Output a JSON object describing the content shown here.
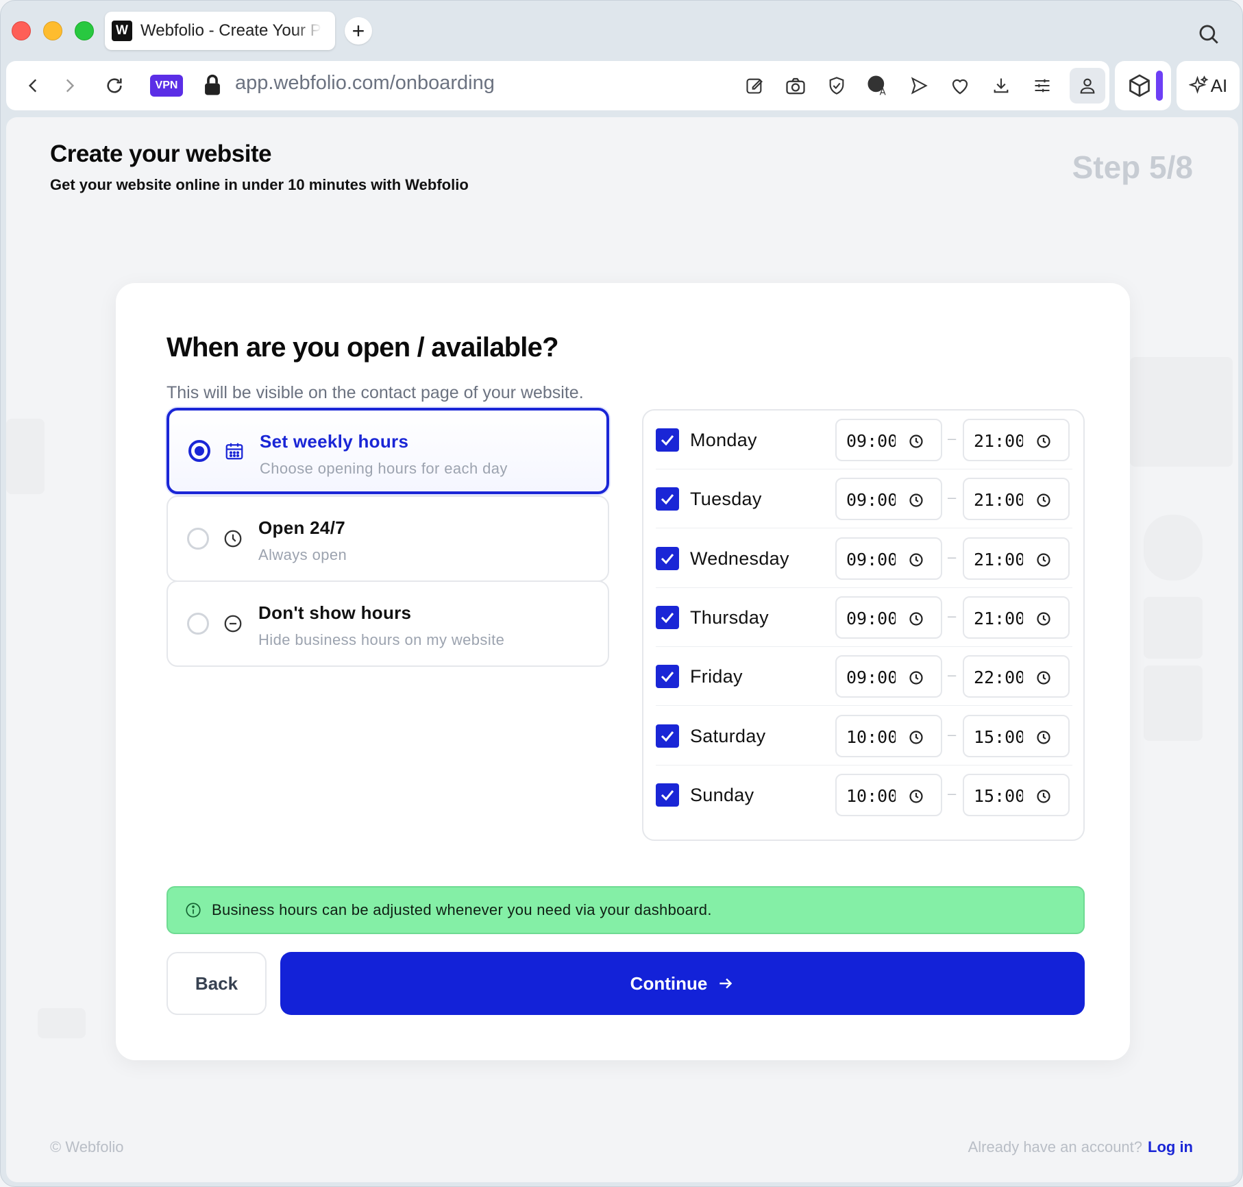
{
  "browser": {
    "tab_title": "Webfolio - Create Your P",
    "favicon_letter": "W",
    "new_tab": "+",
    "vpn_label": "VPN",
    "url_host": "app.webfolio.com",
    "url_path": "/onboarding",
    "ai_label": "AI",
    "icons": [
      "back-icon",
      "forward-icon",
      "reload-icon",
      "lock-icon",
      "edit-icon",
      "camera-icon",
      "shield-icon",
      "translate-icon",
      "send-icon",
      "heart-icon",
      "download-icon",
      "settings-icon",
      "profile-icon",
      "cube-icon",
      "ai-sparkle-icon",
      "search-icon"
    ]
  },
  "header": {
    "title": "Create your website",
    "subtitle": "Get your website online in under 10 minutes with Webfolio",
    "step": "Step 5/8"
  },
  "question": {
    "title": "When are you open / available?",
    "subtitle": "This will be visible on the contact page of your website."
  },
  "options": [
    {
      "title": "Set weekly hours",
      "desc": "Choose opening hours for each day",
      "selected": true,
      "icon": "calendar-icon"
    },
    {
      "title": "Open 24/7",
      "desc": "Always open",
      "selected": false,
      "icon": "clock-icon"
    },
    {
      "title": "Don't show hours",
      "desc": "Hide business hours on my website",
      "selected": false,
      "icon": "minus-circle-icon"
    }
  ],
  "hours": [
    {
      "day": "Monday",
      "checked": true,
      "from": "09:00",
      "to": "21:00"
    },
    {
      "day": "Tuesday",
      "checked": true,
      "from": "09:00",
      "to": "21:00"
    },
    {
      "day": "Wednesday",
      "checked": true,
      "from": "09:00",
      "to": "21:00"
    },
    {
      "day": "Thursday",
      "checked": true,
      "from": "09:00",
      "to": "21:00"
    },
    {
      "day": "Friday",
      "checked": true,
      "from": "09:00",
      "to": "22:00"
    },
    {
      "day": "Saturday",
      "checked": true,
      "from": "10:00",
      "to": "15:00"
    },
    {
      "day": "Sunday",
      "checked": true,
      "from": "10:00",
      "to": "15:00"
    }
  ],
  "notice": "Business hours can be adjusted whenever you need via your dashboard.",
  "buttons": {
    "back": "Back",
    "continue": "Continue"
  },
  "footer": {
    "copyright": "© Webfolio",
    "login_prompt": "Already have an account?",
    "login_link": "Log in"
  },
  "colors": {
    "accent": "#1322d8",
    "notice_bg": "#84efa6",
    "vpn": "#5b2ee6"
  }
}
